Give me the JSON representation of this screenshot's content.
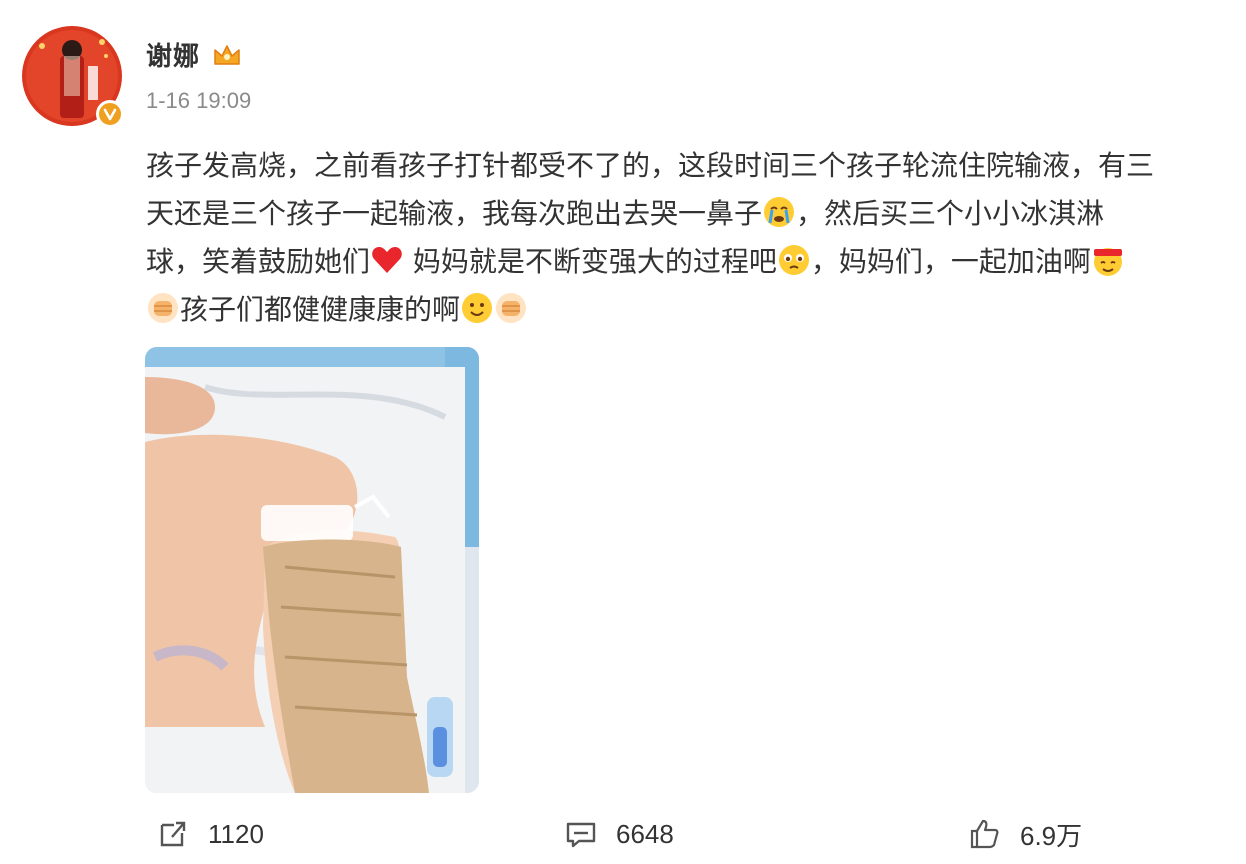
{
  "post": {
    "author": "谢娜",
    "timestamp": "1-16 19:09",
    "text_lines": [
      "孩子发高烧，之前看孩子打针都受不了的，这段时间三个孩子轮流住院输液，有三",
      "天还是三个孩子一起输液，我每次跑出去哭一鼻子",
      "，然后买三个小小冰淇淋",
      "球，笑着鼓励她们",
      " 妈妈就是不断变强大的过程吧",
      "，妈妈们，一起加油啊",
      "孩子们都健健康康的啊"
    ],
    "emojis": [
      "crying-emoji",
      "heart-emoji",
      "teary-emoji",
      "cheer-emoji",
      "fist-emoji",
      "smile-emoji"
    ]
  },
  "stats": {
    "repost_count": "1120",
    "comment_count": "6648",
    "like_count": "6.9万"
  },
  "colors": {
    "text": "#333333",
    "meta": "#8a8a8a",
    "badge": "#f0a020",
    "heart": "#e8262b"
  }
}
